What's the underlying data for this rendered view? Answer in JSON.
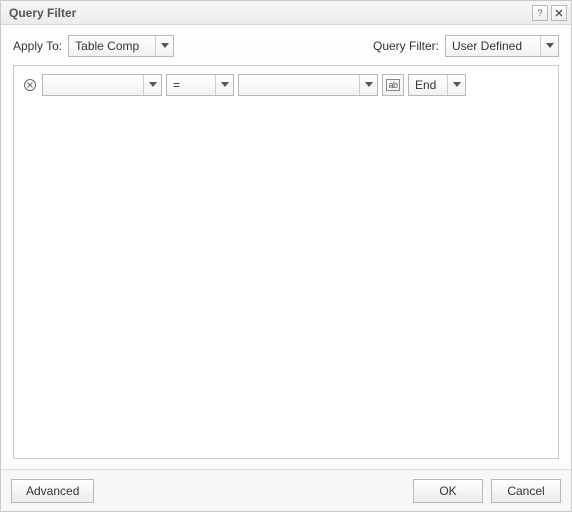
{
  "titlebar": {
    "title": "Query Filter"
  },
  "labels": {
    "apply_to": "Apply To:",
    "query_filter": "Query Filter:"
  },
  "dropdowns": {
    "apply_to_value": "Table Comp",
    "query_filter_value": "User Defined"
  },
  "filter_row": {
    "field": "",
    "operator": "=",
    "value": "",
    "case_label": "ab",
    "logic": "End"
  },
  "buttons": {
    "advanced": "Advanced",
    "ok": "OK",
    "cancel": "Cancel"
  }
}
